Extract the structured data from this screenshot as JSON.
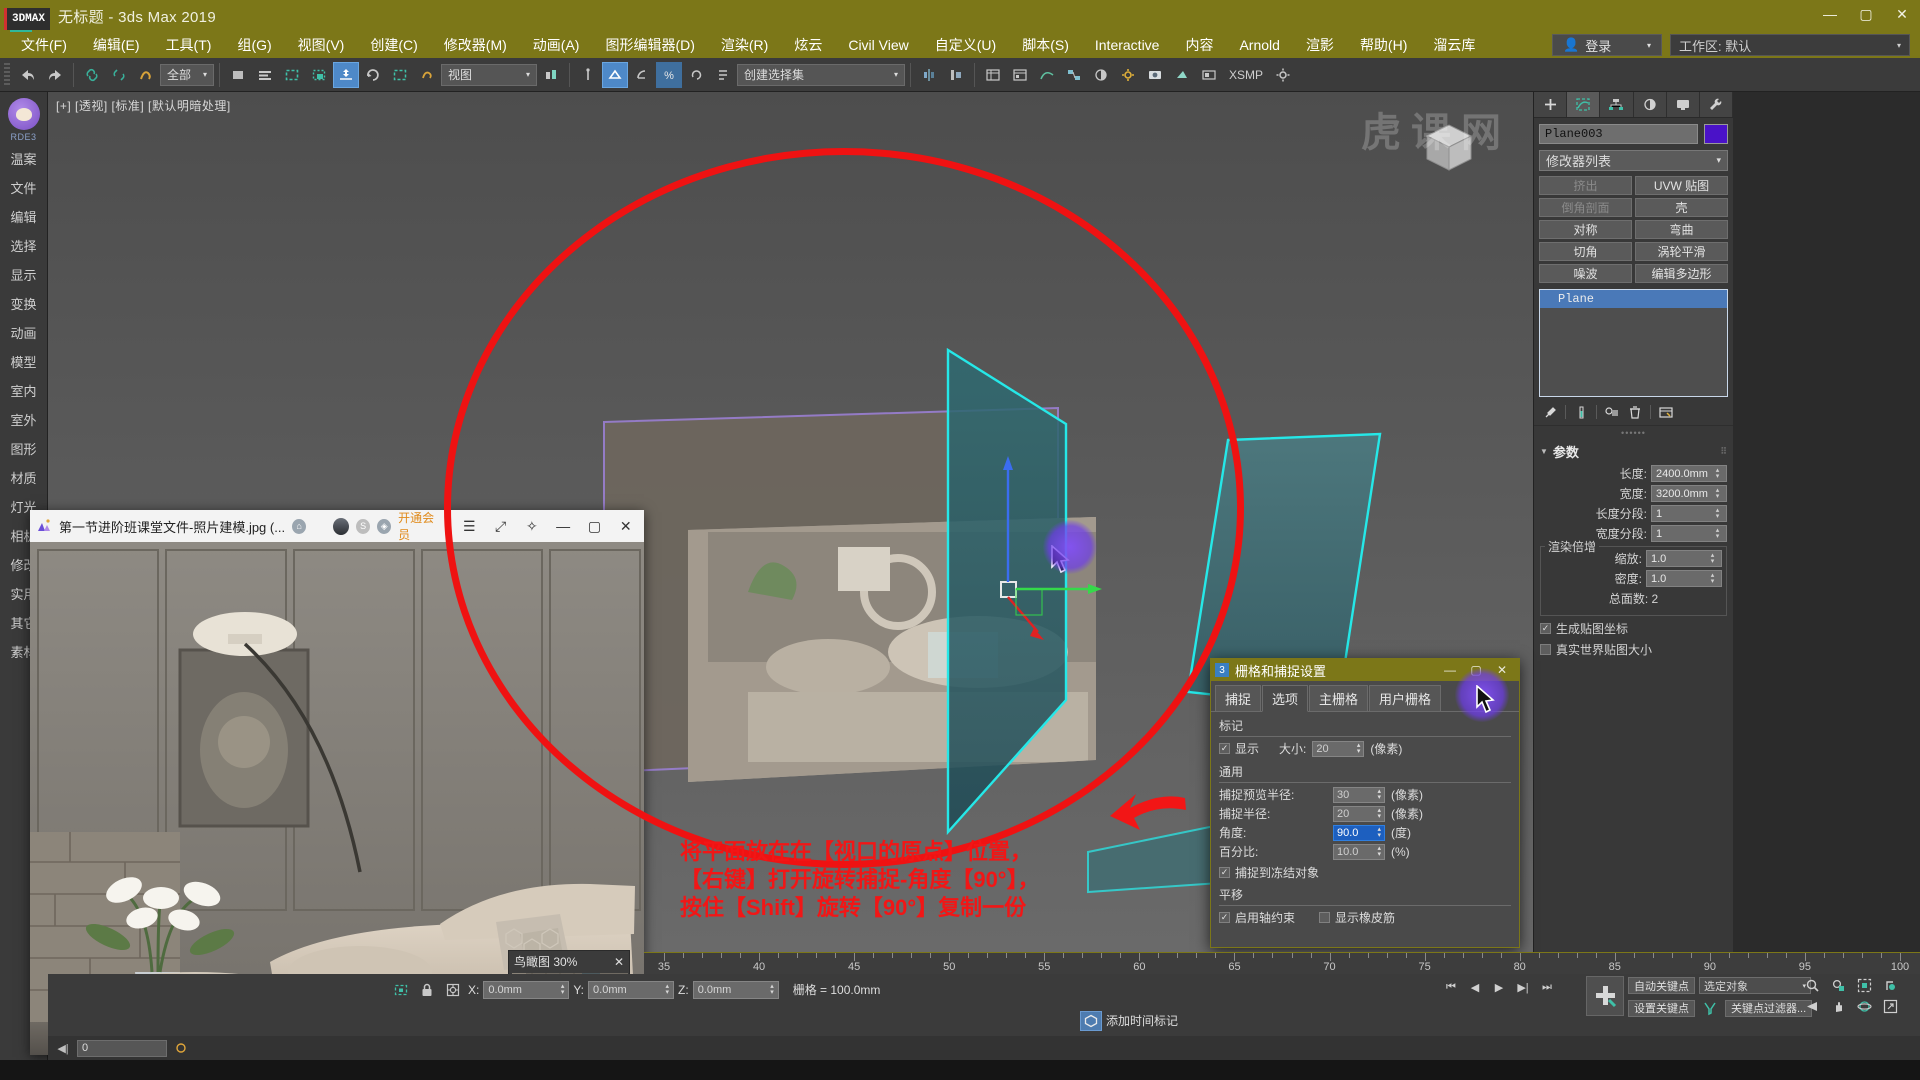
{
  "titlebar": {
    "logo": "3DMAX",
    "title": "无标题 - 3ds Max 2019",
    "minimize": "—",
    "maximize": "▢",
    "close": "✕"
  },
  "menubar": {
    "items": [
      "文件(F)",
      "编辑(E)",
      "工具(T)",
      "组(G)",
      "视图(V)",
      "创建(C)",
      "修改器(M)",
      "动画(A)",
      "图形编辑器(D)",
      "渲染(R)",
      "炫云",
      "Civil View",
      "自定义(U)",
      "脚本(S)",
      "Interactive",
      "内容",
      "Arnold",
      "渲影",
      "帮助(H)",
      "溜云库"
    ],
    "login_label": "登录",
    "login_icon": "user-icon",
    "workspace_label": "工作区: 默认",
    "caret": "▾"
  },
  "toolbar": {
    "selection_filter": "全部",
    "selection_set_placeholder": "创建选择集",
    "coordinate_system": "视图",
    "xsmp_label": "XSMP",
    "caret": "▾"
  },
  "viewport": {
    "label": "[+] [透视] [标准] [默认明暗处理]",
    "viewcube_name": "view-cube"
  },
  "sidebar": {
    "brand": "RDE3",
    "items": [
      "温案",
      "文件",
      "编辑",
      "选择",
      "显示",
      "变换",
      "动画",
      "模型",
      "室内",
      "室外",
      "图形",
      "材质",
      "灯光",
      "相机",
      "修改",
      "实用",
      "其它",
      "素材"
    ]
  },
  "command_panel": {
    "tabs": [
      "create-icon",
      "modify-icon",
      "hierarchy-icon",
      "motion-icon",
      "display-icon",
      "utilities-icon"
    ],
    "selected_tab_index": 1,
    "object_name": "Plane003",
    "object_color": "#4a12c8",
    "modifier_list_label": "修改器列表",
    "modifier_buttons": [
      {
        "label": "挤出",
        "dim": true
      },
      {
        "label": "UVW 贴图",
        "dim": false
      },
      {
        "label": "倒角剖面",
        "dim": true
      },
      {
        "label": "壳",
        "dim": false
      },
      {
        "label": "对称",
        "dim": false
      },
      {
        "label": "弯曲",
        "dim": false
      },
      {
        "label": "切角",
        "dim": false
      },
      {
        "label": "涡轮平滑",
        "dim": false
      },
      {
        "label": "噪波",
        "dim": false
      },
      {
        "label": "编辑多边形",
        "dim": false
      }
    ],
    "modifier_stack": [
      {
        "label": "Plane",
        "selected": true
      }
    ],
    "stack_tools": [
      "pin-stack-icon",
      "show-end-result-icon",
      "make-unique-icon",
      "delete-modifier-icon",
      "configure-sets-icon"
    ],
    "rollout_title": "参数",
    "params": [
      {
        "label": "长度:",
        "value": "2400.0mm"
      },
      {
        "label": "宽度:",
        "value": "3200.0mm"
      },
      {
        "label": "长度分段:",
        "value": "1"
      },
      {
        "label": "宽度分段:",
        "value": "1"
      }
    ],
    "render_group_title": "渲染倍增",
    "render_params": [
      {
        "label": "缩放:",
        "value": "1.0"
      },
      {
        "label": "密度:",
        "value": "1.0"
      }
    ],
    "total_faces_label": "总面数: 2",
    "checkboxes": [
      {
        "label": "生成贴图坐标",
        "checked": true
      },
      {
        "label": "真实世界贴图大小",
        "checked": false
      }
    ]
  },
  "image_window": {
    "title": "第一节进阶班课堂文件-照片建模.jpg (...",
    "vip_label": "开通会员",
    "menu_icon": "hamburger-icon",
    "fullscreen_icon": "expand-icon",
    "pin_icon": "pin-icon",
    "minimize": "—",
    "maximize": "▢",
    "close": "✕"
  },
  "minimap": {
    "title": "鸟瞰图 30%",
    "close": "✕"
  },
  "snap_dialog": {
    "title": "栅格和捕捉设置",
    "icon_badge": "3",
    "minimize": "—",
    "maximize": "▢",
    "close": "✕",
    "tabs": [
      "捕捉",
      "选项",
      "主栅格",
      "用户栅格"
    ],
    "selected_tab": "选项",
    "section_marker": "标记",
    "marker_show_label": "显示",
    "marker_show_checked": true,
    "marker_size_label": "大小:",
    "marker_size_value": "20",
    "marker_size_unit": "(像素)",
    "section_general": "通用",
    "general_rows": [
      {
        "label": "捕捉预览半径:",
        "value": "30",
        "unit": "(像素)",
        "highlight": false
      },
      {
        "label": "捕捉半径:",
        "value": "20",
        "unit": "(像素)",
        "highlight": false
      },
      {
        "label": "角度:",
        "value": "90.0",
        "unit": "(度)",
        "highlight": true
      },
      {
        "label": "百分比:",
        "value": "10.0",
        "unit": "(%)",
        "highlight": false
      }
    ],
    "snap_frozen_label": "捕捉到冻结对象",
    "snap_frozen_checked": true,
    "section_translate": "平移",
    "axis_constraint_label": "启用轴约束",
    "axis_constraint_checked": true,
    "rubber_band_label": "显示橡皮筋",
    "rubber_band_checked": false
  },
  "timeline": {
    "ticks": [
      35,
      40,
      45,
      50,
      55,
      60,
      65,
      70,
      75,
      80,
      85,
      90,
      95,
      100
    ]
  },
  "statusbar": {
    "x_label": "X:",
    "x_value": "0.0mm",
    "y_label": "Y:",
    "y_value": "0.0mm",
    "z_label": "Z:",
    "z_value": "0.0mm",
    "grid_label": "栅格 = 100.0mm",
    "add_time_tag": "添加时间标记",
    "lock_icon": "lock-icon",
    "selection_icon": "selection-lock-icon",
    "absolute_icon": "absolute-mode-icon"
  },
  "animation_controls": {
    "auto_key": "自动关键点",
    "set_key": "设置关键点",
    "selected_objects": "选定对象",
    "key_filters": "关键点过滤器...",
    "caret": "▾"
  },
  "trackbar": {
    "frame_value": "0"
  },
  "annotation": {
    "text": "将平面放在在【视口的原点】位置，\n【右键】打开旋转捕捉-角度【90°】，\n按住【Shift】旋转【90°】复制一份",
    "color": "#f21616",
    "circle_color": "#ef1212",
    "arrow_name": "red-arrow-annotation"
  },
  "watermark": "虎课网"
}
